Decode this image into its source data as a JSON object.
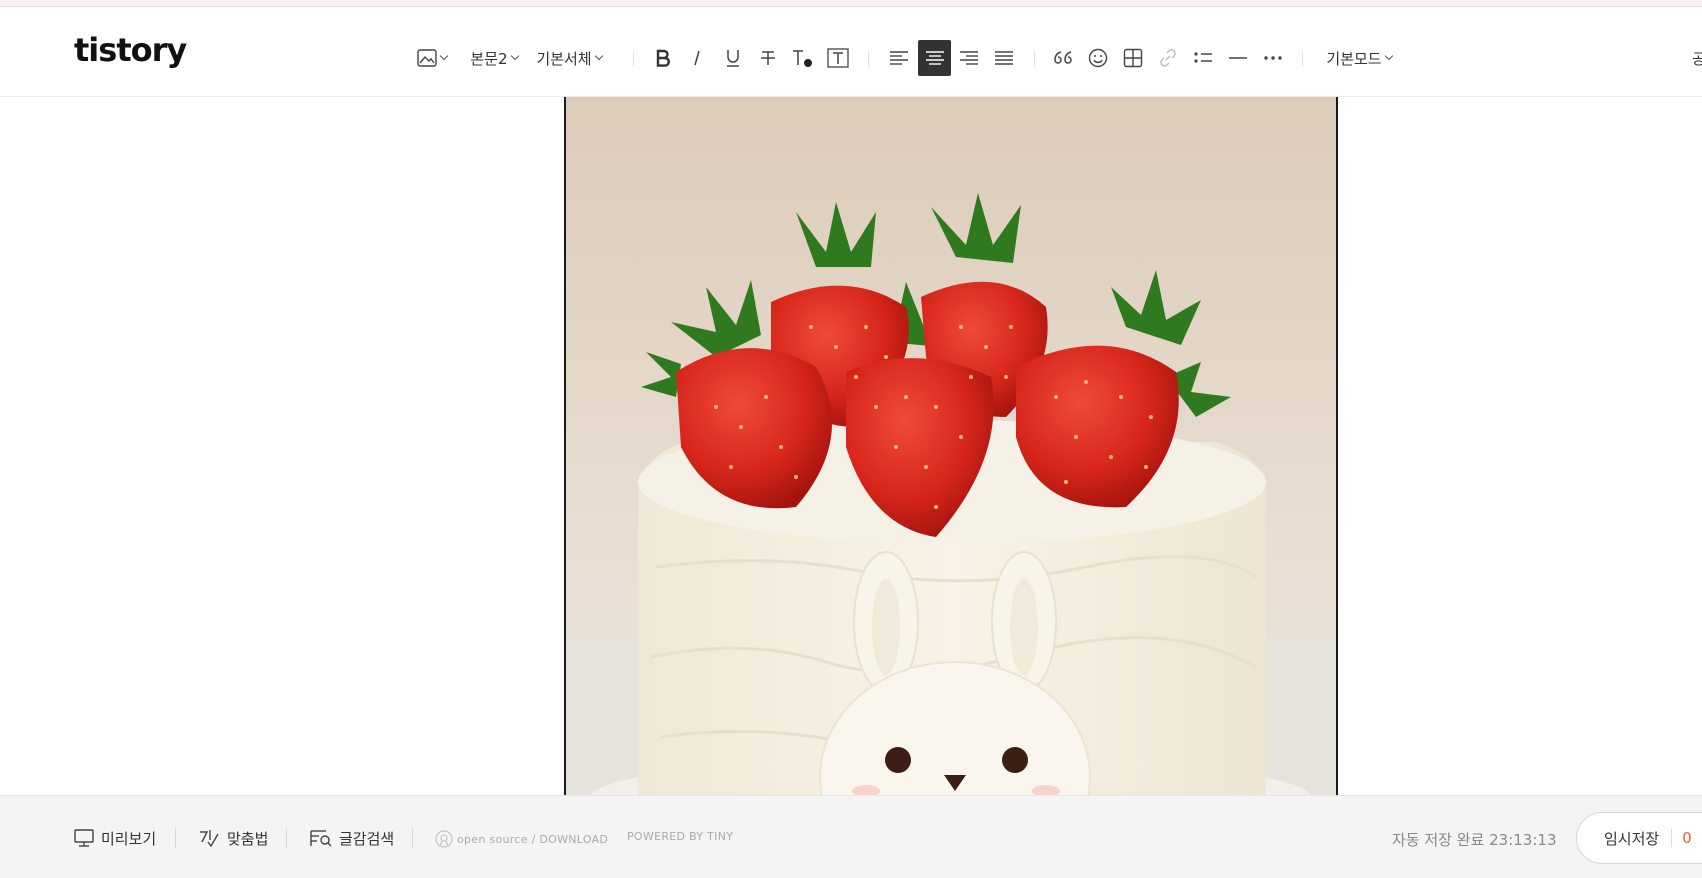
{
  "header": {
    "logo": "tistory",
    "toolbar": {
      "paragraph_style": "본문2",
      "font": "기본서체",
      "mode": "기본모드",
      "right_edge_char": "공"
    }
  },
  "editor": {
    "image": {
      "subject": "strawberry-bunny-cake"
    }
  },
  "footer": {
    "preview": "미리보기",
    "spellcheck": "맞춤법",
    "search": "글감검색",
    "open_source": "open source / DOWNLOAD",
    "powered": "POWERED BY TINY",
    "autosave_label": "자동 저장 완료",
    "autosave_time": "23:13:13",
    "temp_save": "임시저장",
    "temp_count": "0"
  },
  "colors": {
    "accent": "#f55a2c",
    "active_toolbar": "#333333"
  }
}
